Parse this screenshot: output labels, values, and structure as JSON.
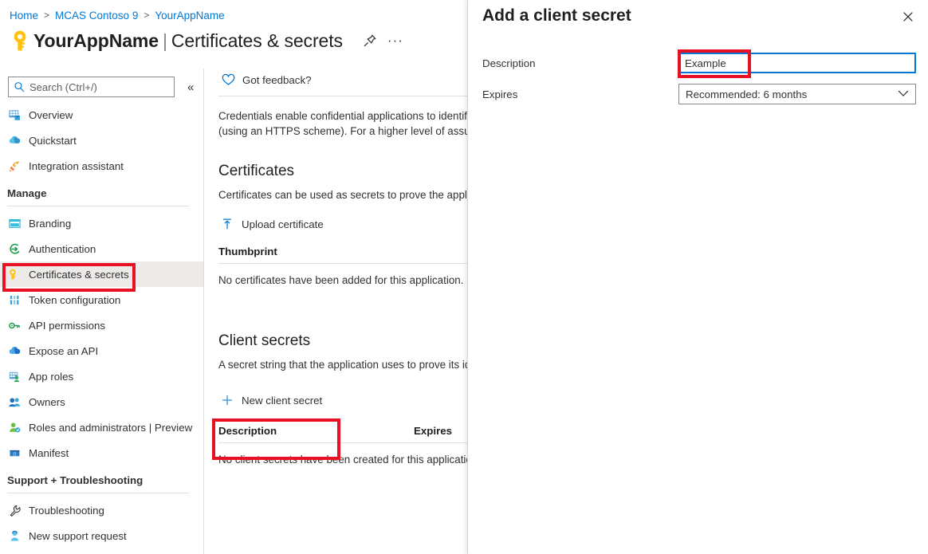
{
  "breadcrumb": [
    {
      "label": "Home"
    },
    {
      "label": "MCAS Contoso 9"
    },
    {
      "label": "YourAppName"
    }
  ],
  "breadcrumb_separator": ">",
  "header": {
    "app_name": "YourAppName",
    "separator": "|",
    "section": "Certificates & secrets",
    "key_icon": "key-icon",
    "pin_icon": "pin-icon",
    "more_icon": "ellipsis-icon"
  },
  "search": {
    "placeholder": "Search (Ctrl+/)",
    "value": "",
    "icon": "search-icon",
    "collapse_icon": "chevron-double-left-icon",
    "collapse_glyph": "«"
  },
  "sidebar": {
    "items": [
      {
        "label": "Overview",
        "icon": "grid-overview-icon",
        "selected": false
      },
      {
        "label": "Quickstart",
        "icon": "cloud-quickstart-icon",
        "selected": false
      },
      {
        "label": "Integration assistant",
        "icon": "rocket-icon",
        "selected": false
      }
    ],
    "groups": [
      {
        "title": "Manage",
        "items": [
          {
            "label": "Branding",
            "icon": "branding-window-icon",
            "selected": false
          },
          {
            "label": "Authentication",
            "icon": "authentication-arrow-icon",
            "selected": false
          },
          {
            "label": "Certificates & secrets",
            "icon": "key-icon",
            "selected": true
          },
          {
            "label": "Token configuration",
            "icon": "token-bars-icon",
            "selected": false
          },
          {
            "label": "API permissions",
            "icon": "api-permissions-key-icon",
            "selected": false
          },
          {
            "label": "Expose an API",
            "icon": "cloud-api-icon",
            "selected": false
          },
          {
            "label": "App roles",
            "icon": "app-roles-icon",
            "selected": false
          },
          {
            "label": "Owners",
            "icon": "owners-people-icon",
            "selected": false
          },
          {
            "label": "Roles and administrators | Preview",
            "icon": "roles-admin-icon",
            "selected": false
          },
          {
            "label": "Manifest",
            "icon": "manifest-icon",
            "selected": false
          }
        ]
      },
      {
        "title": "Support + Troubleshooting",
        "items": [
          {
            "label": "Troubleshooting",
            "icon": "wrench-icon",
            "selected": false
          },
          {
            "label": "New support request",
            "icon": "support-person-icon",
            "selected": false
          }
        ]
      }
    ]
  },
  "main": {
    "feedback": {
      "label": "Got feedback?",
      "icon": "heart-icon"
    },
    "intro_line1": "Credentials enable confidential applications to identify",
    "intro_line2": "(using an HTTPS scheme). For a higher level of assuran",
    "certificates": {
      "title": "Certificates",
      "description": "Certificates can be used as secrets to prove the applica",
      "upload_button": "Upload certificate",
      "upload_icon": "upload-arrow-icon",
      "column_thumbprint": "Thumbprint",
      "empty_message": "No certificates have been added for this application."
    },
    "client_secrets": {
      "title": "Client secrets",
      "description": "A secret string that the application uses to prove its id",
      "new_button": "New client secret",
      "new_icon": "plus-icon",
      "column_description": "Description",
      "column_expires": "Expires",
      "empty_message": "No client secrets have been created for this application"
    }
  },
  "panel": {
    "title": "Add a client secret",
    "close_icon": "close-icon",
    "close_glyph": "✕",
    "description_label": "Description",
    "description_value": "Example",
    "expires_label": "Expires",
    "expires_value": "Recommended: 6 months",
    "expires_chevron_icon": "chevron-down-icon",
    "expires_chevron_glyph": "⌄"
  },
  "annotations": {
    "highlight_color": "#e81123",
    "boxes": [
      {
        "name": "certificates-and-secrets-nav-highlight"
      },
      {
        "name": "new-client-secret-highlight"
      },
      {
        "name": "description-input-highlight"
      }
    ]
  },
  "colors": {
    "link": "#0078d4",
    "accent": "#0078d4",
    "selected_row": "#edebe9",
    "border": "#e1dfdd",
    "text": "#323130",
    "key_gold": "#ffc20e"
  }
}
